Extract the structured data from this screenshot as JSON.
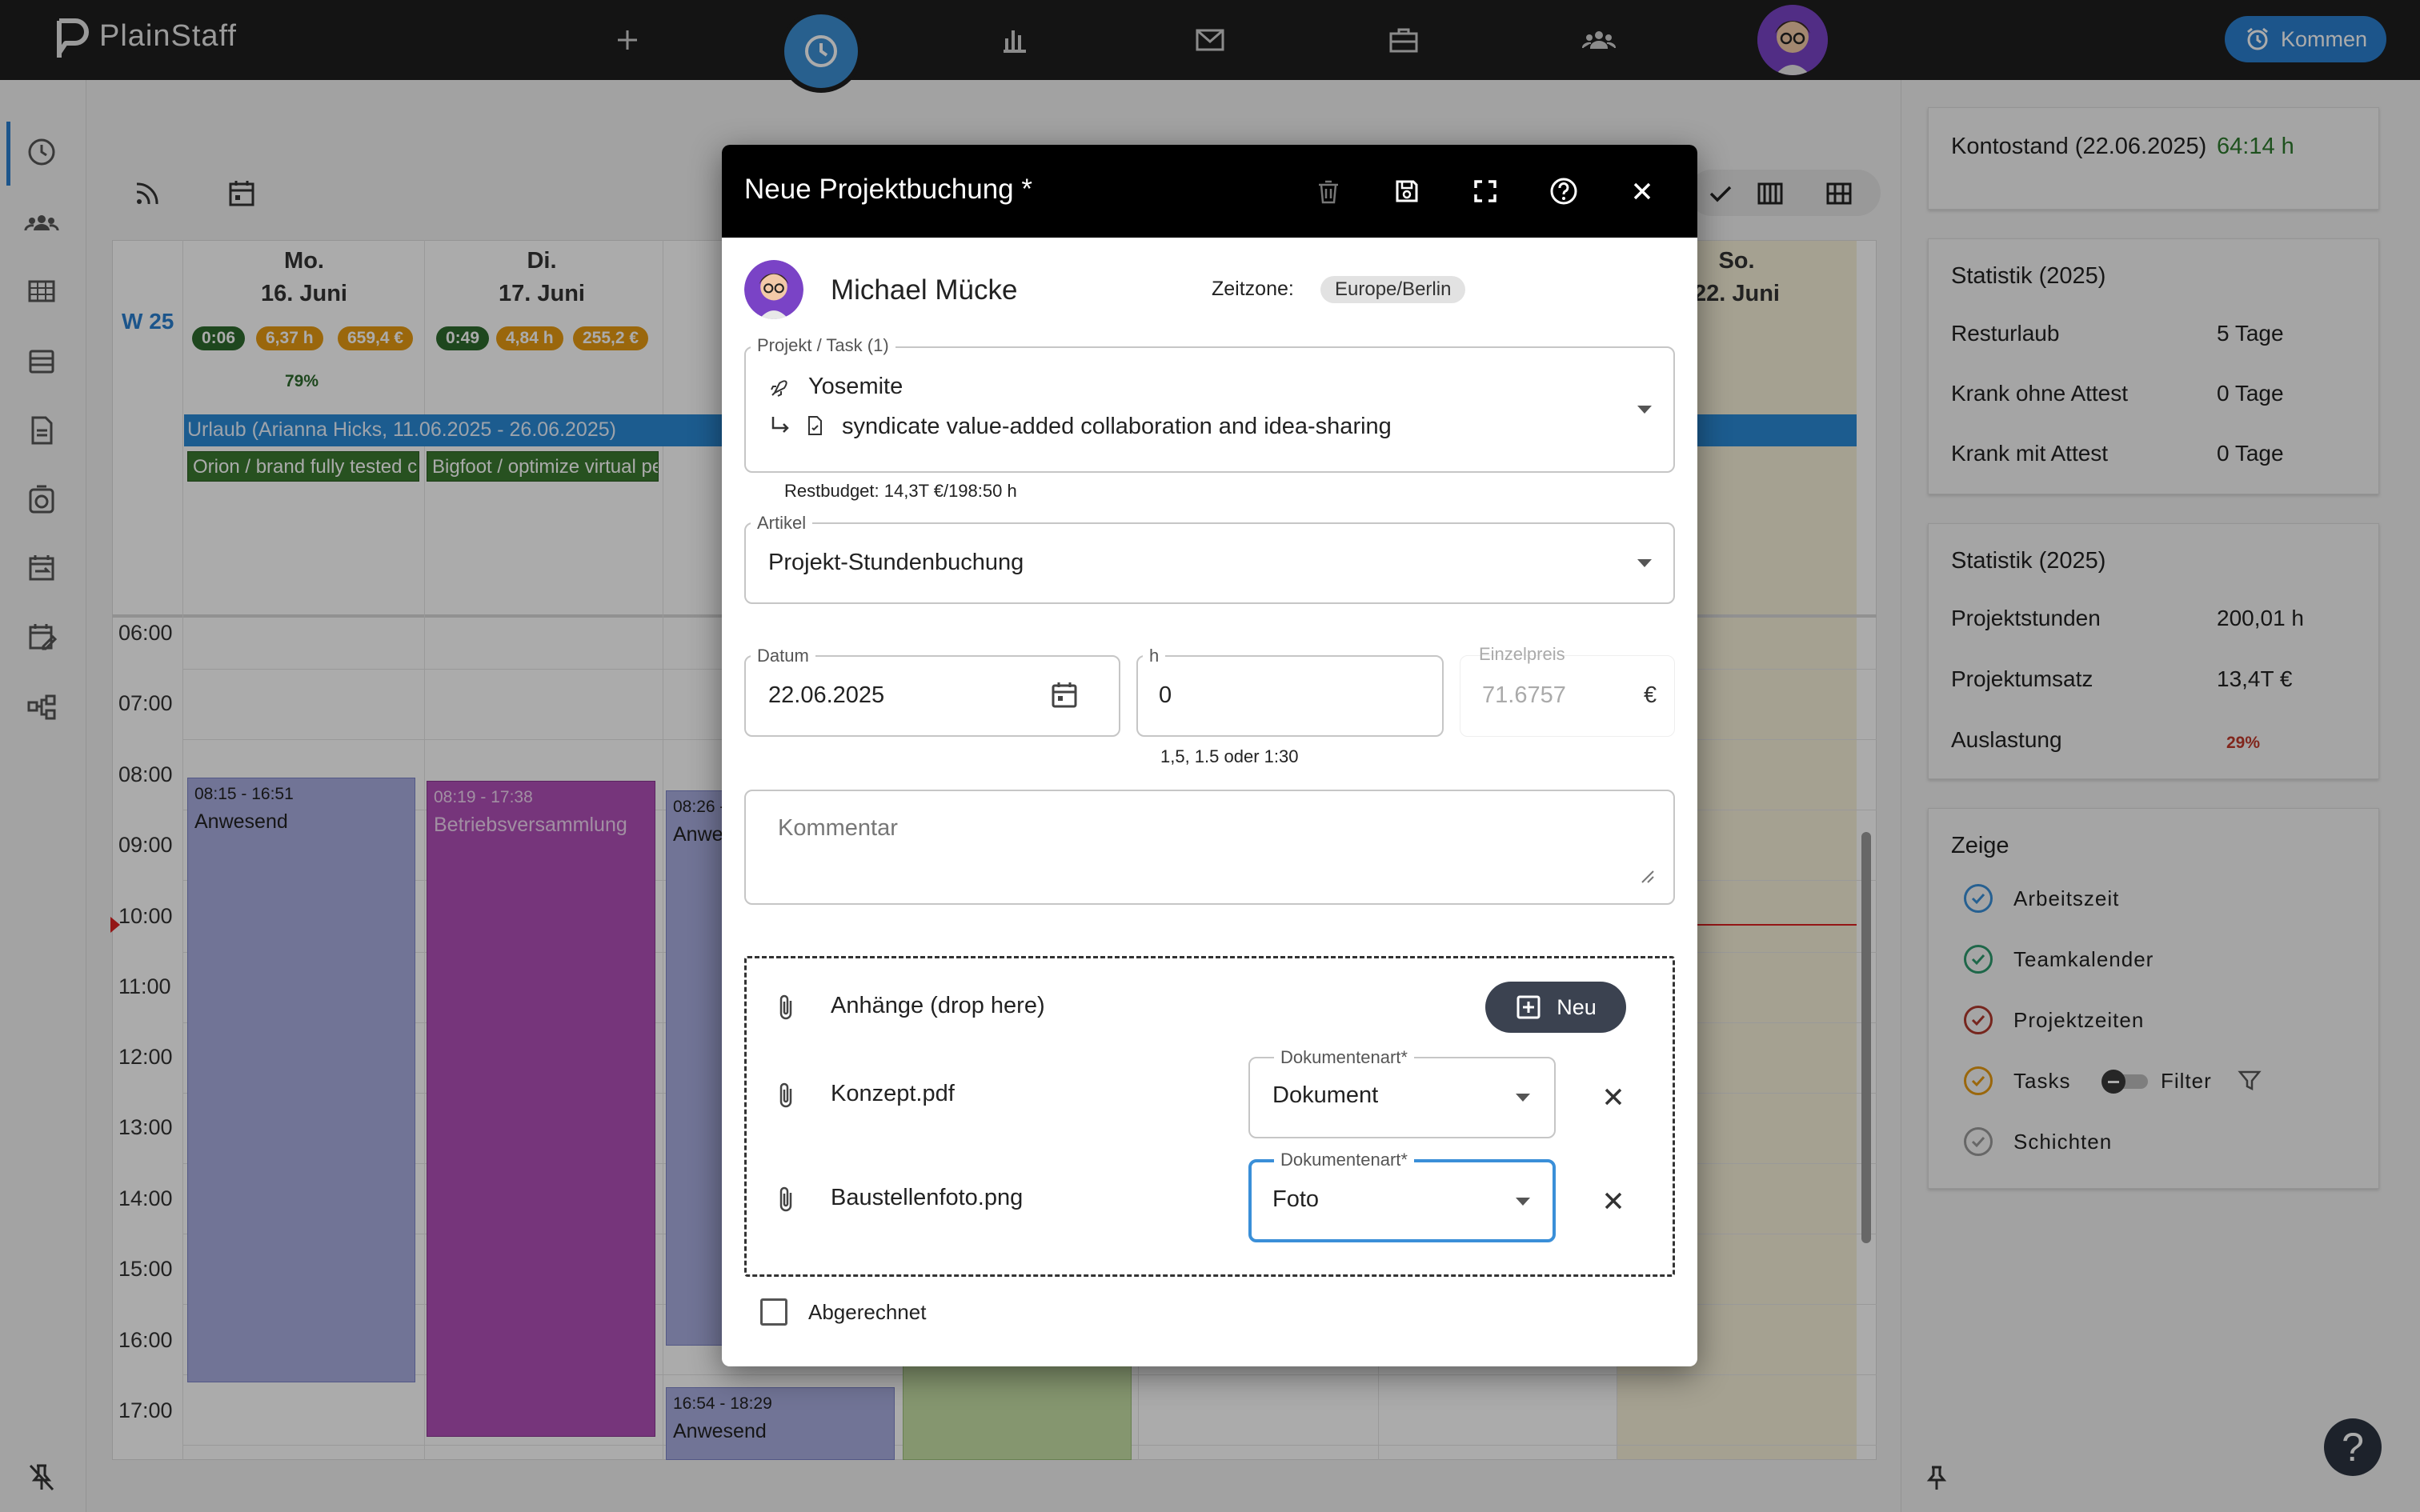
{
  "app": {
    "name": "PlainStaff",
    "clock_in_label": "Kommen"
  },
  "calendar": {
    "week_label": "W 25",
    "days": [
      {
        "weekday": "Mo.",
        "date": "16. Juni"
      },
      {
        "weekday": "Di.",
        "date": "17. Juni"
      },
      {
        "weekday": "So.",
        "date": "22. Juni"
      }
    ],
    "badges_mon": [
      "0:06",
      "6,37 h",
      "659,4 €"
    ],
    "badges_tue": [
      "0:49",
      "4,84 h",
      "255,2 €"
    ],
    "utilization_mon": "79%",
    "hours": [
      "06:00",
      "07:00",
      "08:00",
      "09:00",
      "10:00",
      "11:00",
      "12:00",
      "13:00",
      "14:00",
      "15:00",
      "16:00",
      "17:00"
    ],
    "allday_vacation": "Urlaub (Arianna Hicks, 11.06.2025 - 26.06.2025)",
    "allday_tasks": [
      "Orion / brand fully tested c",
      "Bigfoot / optimize virtual pe"
    ],
    "events": [
      {
        "time": "08:15 - 16:51",
        "name": "Anwesend"
      },
      {
        "time": "08:19 - 17:38",
        "name": "Betriebsversammlung"
      },
      {
        "time": "08:26 -",
        "name": "Anwe"
      },
      {
        "time": "16:54 - 18:29",
        "name": "Anwesend"
      }
    ]
  },
  "right_panel": {
    "balance_label": "Kontostand (22.06.2025)",
    "balance_value": "64:14 h",
    "stats1": {
      "title": "Statistik (2025)",
      "rows": [
        {
          "label": "Resturlaub",
          "value": "5 Tage"
        },
        {
          "label": "Krank ohne Attest",
          "value": "0 Tage"
        },
        {
          "label": "Krank mit Attest",
          "value": "0 Tage"
        }
      ]
    },
    "stats2": {
      "title": "Statistik (2025)",
      "rows": [
        {
          "label": "Projektstunden",
          "value": "200,01 h"
        },
        {
          "label": "Projektumsatz",
          "value": "13,4T €"
        },
        {
          "label": "Auslastung",
          "value": "29%"
        }
      ]
    },
    "show": {
      "title": "Zeige",
      "items": [
        "Arbeitszeit",
        "Teamkalender",
        "Projektzeiten",
        "Tasks",
        "Schichten"
      ],
      "filter_label": "Filter"
    }
  },
  "modal": {
    "title": "Neue Projektbuchung *",
    "user_name": "Michael Mücke",
    "timezone_label": "Zeitzone:",
    "timezone_value": "Europe/Berlin",
    "project_label": "Projekt / Task (1)",
    "project_name": "Yosemite",
    "task_name": "syndicate value-added collaboration and idea-sharing",
    "remaining_budget": "Restbudget: 14,3T €/198:50 h",
    "article_label": "Artikel",
    "article_value": "Projekt-Stundenbuchung",
    "date_label": "Datum",
    "date_value": "22.06.2025",
    "hours_label": "h",
    "hours_value": "0",
    "hours_hint": "1,5, 1.5 oder 1:30",
    "price_label": "Einzelpreis",
    "price_value": "71.6757",
    "price_currency": "€",
    "comment_placeholder": "Kommentar",
    "attachments_label": "Anhänge (drop here)",
    "new_button": "Neu",
    "doc_type_label": "Dokumentenart*",
    "attachments": [
      {
        "file": "Konzept.pdf",
        "type": "Dokument"
      },
      {
        "file": "Baustellenfoto.png",
        "type": "Foto"
      }
    ],
    "billed_label": "Abgerechnet"
  }
}
